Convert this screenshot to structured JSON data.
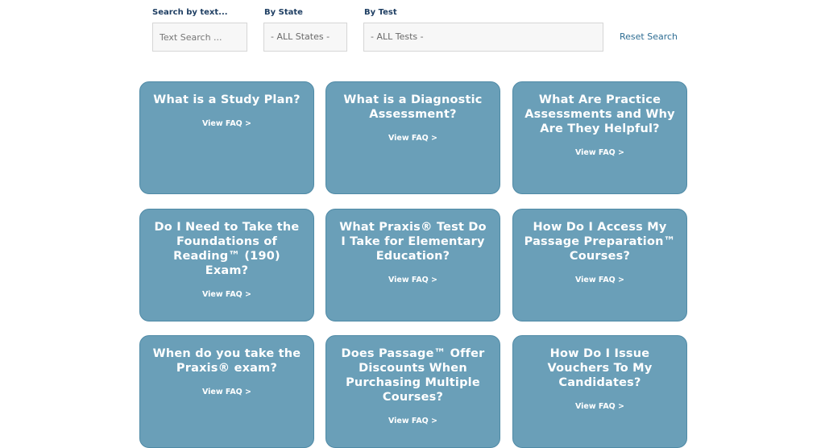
{
  "filters": {
    "text_label": "Search by text...",
    "text_placeholder": "Text Search ...",
    "state_label": "By State",
    "state_value": "- ALL States -",
    "test_label": "By Test",
    "test_value": "- ALL Tests -",
    "reset_label": "Reset Search"
  },
  "cards": [
    {
      "title": "What is a Study Plan?",
      "link": "View FAQ >"
    },
    {
      "title": "What is a Diagnostic Assessment?",
      "link": "View FAQ >"
    },
    {
      "title": "What Are Practice Assessments and Why Are They Helpful?",
      "link": "View FAQ >"
    },
    {
      "title": "Do I Need to Take the Foundations of Reading™ (190) Exam?",
      "link": "View FAQ >"
    },
    {
      "title": "What Praxis® Test Do I Take for Elementary Education?",
      "link": "View FAQ >"
    },
    {
      "title": "How Do I Access My Passage Preparation™ Courses?",
      "link": "View FAQ >"
    },
    {
      "title": "When do you take the Praxis® exam?",
      "link": "View FAQ >"
    },
    {
      "title": "Does Passage™ Offer Discounts When Purchasing Multiple Courses?",
      "link": "View FAQ >"
    },
    {
      "title": "How Do I Issue Vouchers To My Candidates?",
      "link": "View FAQ >"
    }
  ],
  "colors": {
    "card_background": "#6a9fb8",
    "label_text": "#1f3f63",
    "link_text": "#2e6d93"
  }
}
